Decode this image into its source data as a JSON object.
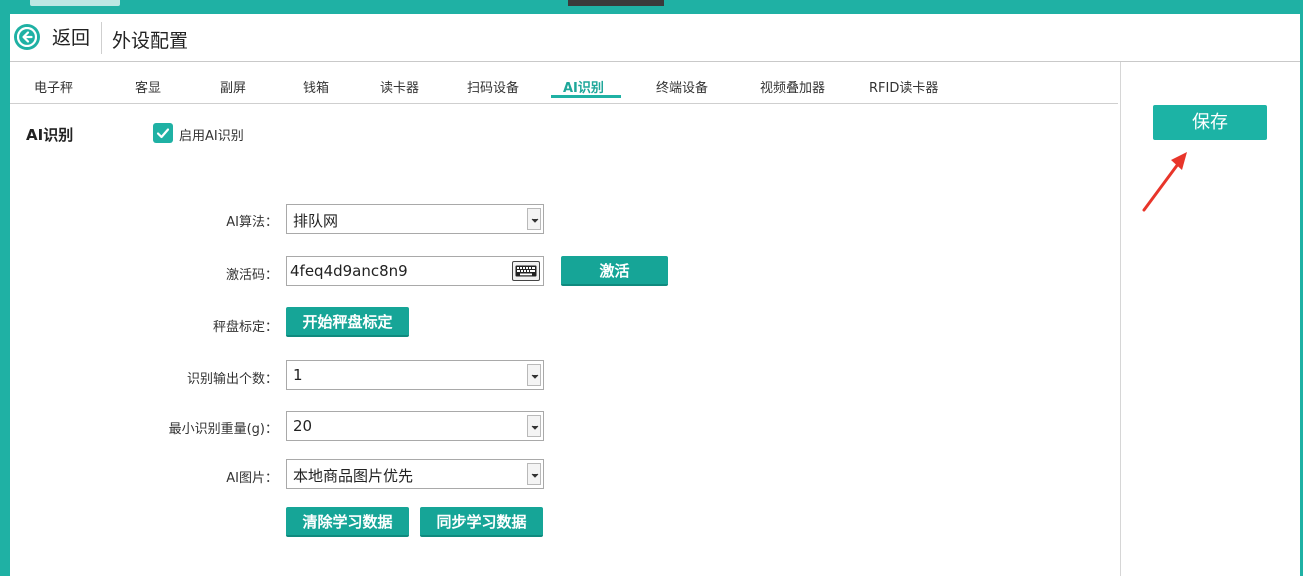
{
  "header": {
    "back_label": "返回",
    "title": "外设配置"
  },
  "tabs": [
    {
      "label": "电子秤",
      "active": false
    },
    {
      "label": "客显",
      "active": false
    },
    {
      "label": "副屏",
      "active": false
    },
    {
      "label": "钱箱",
      "active": false
    },
    {
      "label": "读卡器",
      "active": false
    },
    {
      "label": "扫码设备",
      "active": false
    },
    {
      "label": "AI识别",
      "active": true
    },
    {
      "label": "终端设备",
      "active": false
    },
    {
      "label": "视频叠加器",
      "active": false
    },
    {
      "label": "RFID读卡器",
      "active": false
    }
  ],
  "section": {
    "title": "AI识别",
    "enable_label": "启用AI识别",
    "enable_checked": true
  },
  "form": {
    "algorithm": {
      "label": "AI算法：",
      "value": "排队网"
    },
    "activation_code": {
      "label": "激活码：",
      "value": "4feq4d9anc8n9",
      "activate_button": "激活"
    },
    "scale_calibration": {
      "label": "秤盘标定：",
      "button": "开始秤盘标定"
    },
    "output_count": {
      "label": "识别输出个数：",
      "value": "1"
    },
    "min_weight": {
      "label": "最小识别重量(g)：",
      "value": "20"
    },
    "ai_image": {
      "label": "AI图片：",
      "value": "本地商品图片优先"
    },
    "clear_button": "清除学习数据",
    "sync_button": "同步学习数据"
  },
  "right": {
    "save_label": "保存"
  },
  "colors": {
    "accent": "#1fb1a4",
    "button": "#16a597",
    "annotation_arrow": "#e8352a"
  },
  "icons": {
    "back": "back-arrow-icon",
    "checkbox": "checkmark-icon",
    "keyboard": "keyboard-icon",
    "dropdown": "chevron-down-icon"
  }
}
